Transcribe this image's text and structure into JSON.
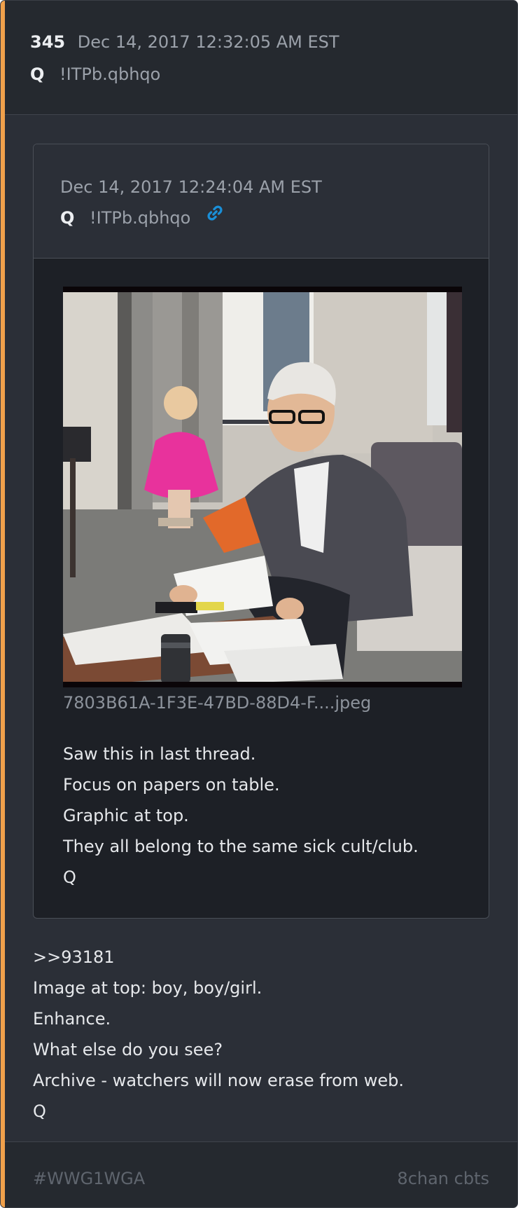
{
  "post": {
    "number": "345",
    "timestamp": "Dec 14, 2017 12:32:05 AM EST",
    "author": "Q",
    "tripcode": "!ITPb.qbhqo",
    "accent_color": "#f0a04b",
    "quoted": {
      "timestamp": "Dec 14, 2017 12:24:04 AM EST",
      "author": "Q",
      "tripcode": "!ITPb.qbhqo",
      "link_icon": "link-icon",
      "image": {
        "description": "photo",
        "filename": "7803B61A-1F3E-47BD-88D4-F....jpeg"
      },
      "lines": [
        "Saw this in last thread.",
        "Focus on papers on table.",
        "Graphic at top.",
        "They all belong to the same sick cult/club.",
        "Q"
      ]
    },
    "lines": [
      ">>93181",
      "Image at top: boy, boy/girl.",
      "Enhance.",
      "What else do you see?",
      "Archive - watchers will now erase from web.",
      "Q"
    ]
  },
  "footer": {
    "tag": "#WWG1WGA",
    "source": "8chan cbts"
  }
}
